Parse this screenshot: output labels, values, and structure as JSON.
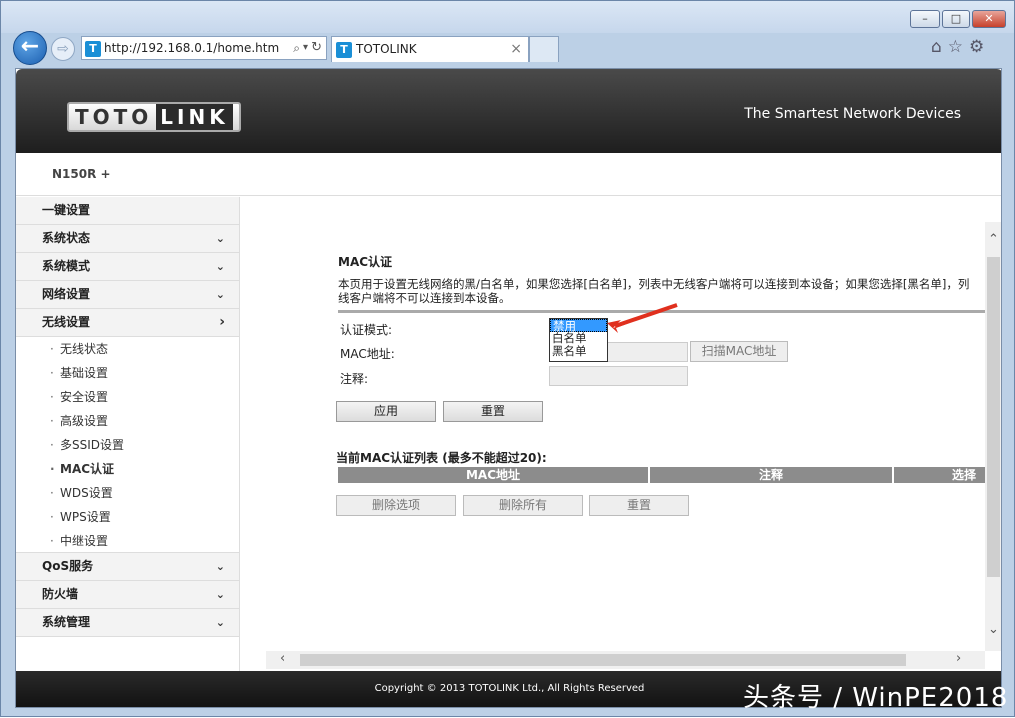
{
  "browser": {
    "url": "http://192.168.0.1/home.htm",
    "tab_title": "TOTOLINK",
    "tab_close": "×",
    "favicon_letter": "T",
    "search_icon": "search-icon",
    "dropdown_glyph": "▾",
    "refresh_glyph": "↻",
    "back_glyph": "←",
    "forward_glyph": "⇨",
    "toolbar_glyphs": "⌂☆⚙",
    "window_buttons": {
      "minimize": "–",
      "maximize": "□",
      "close": "✕"
    }
  },
  "header": {
    "logo_left": "TOTO",
    "logo_right": "LINK",
    "slogan": "The Smartest Network Devices"
  },
  "model": "N150R +",
  "sidebar": {
    "items": [
      {
        "label": "一键设置",
        "arrow": ""
      },
      {
        "label": "系统状态",
        "arrow": "⌄"
      },
      {
        "label": "系统模式",
        "arrow": "⌄"
      },
      {
        "label": "网络设置",
        "arrow": "⌄"
      },
      {
        "label": "无线设置",
        "arrow": "›"
      }
    ],
    "subitems": [
      {
        "label": "无线状态",
        "active": false
      },
      {
        "label": "基础设置",
        "active": false
      },
      {
        "label": "安全设置",
        "active": false
      },
      {
        "label": "高级设置",
        "active": false
      },
      {
        "label": "多SSID设置",
        "active": false
      },
      {
        "label": "MAC认证",
        "active": true
      },
      {
        "label": "WDS设置",
        "active": false
      },
      {
        "label": "WPS设置",
        "active": false
      },
      {
        "label": "中继设置",
        "active": false
      }
    ],
    "items_bottom": [
      {
        "label": "QoS服务",
        "arrow": "⌄"
      },
      {
        "label": "防火墙",
        "arrow": "⌄"
      },
      {
        "label": "系统管理",
        "arrow": "⌄"
      }
    ]
  },
  "page": {
    "title": "MAC认证",
    "desc_line1": "本页用于设置无线网络的黑/白名单，如果您选择[白名单]，列表中无线客户端将可以连接到本设备；如果您选择[黑名单]，列",
    "desc_line2": "线客户端将不可以连接到本设备。",
    "auth_mode_label": "认证模式:",
    "auth_mode_options": [
      "禁用",
      "白名单",
      "黑名单"
    ],
    "auth_mode_selected": "禁用",
    "mac_label": "MAC地址:",
    "note_label": "注释:",
    "scan_button": "扫描MAC地址",
    "apply_button": "应用",
    "reset_button": "重置",
    "list_title": "当前MAC认证列表 (最多不能超过20):",
    "columns": [
      "MAC地址",
      "注释",
      "选择"
    ],
    "delete_selected_button": "删除选项",
    "delete_all_button": "删除所有",
    "list_reset_button": "重置"
  },
  "footer": "Copyright © 2013 TOTOLINK Ltd.,   All Rights Reserved",
  "watermark": "头条号 / WinPE2018",
  "colors": {
    "highlight": "#3399ff",
    "annotation_arrow": "#e0301e",
    "header_dark": "#1e1e1e"
  }
}
